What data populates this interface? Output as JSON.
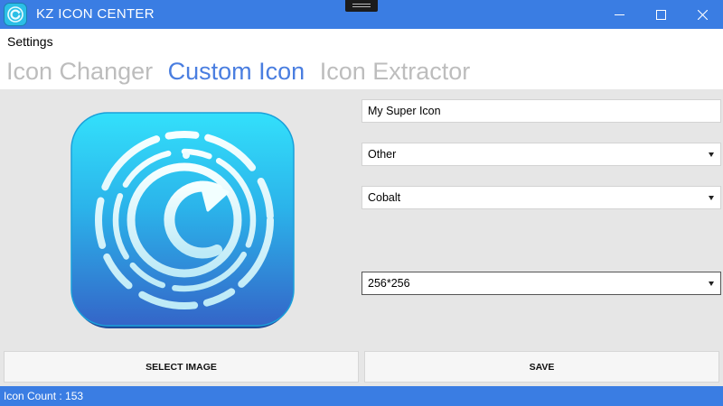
{
  "app": {
    "title": "KZ ICON CENTER"
  },
  "menu": {
    "settings": "Settings"
  },
  "tabs": [
    {
      "label": "Icon Changer",
      "active": false
    },
    {
      "label": "Custom Icon",
      "active": true
    },
    {
      "label": "Icon Extractor",
      "active": false
    }
  ],
  "form": {
    "name_value": "My Super Icon",
    "category_value": "Other",
    "color_value": "Cobalt",
    "size_value": "256*256"
  },
  "buttons": {
    "select_image": "SELECT IMAGE",
    "save": "SAVE"
  },
  "status": {
    "icon_count": "Icon Count : 153"
  },
  "colors": {
    "accent": "#3a7de3",
    "active_tab": "#4a7ee0",
    "inactive_tab": "#bdbdbd"
  },
  "icons": [
    "app-icon",
    "minimize-icon",
    "maximize-icon",
    "close-icon",
    "refresh-icon",
    "dropdown-arrow-icon"
  ]
}
